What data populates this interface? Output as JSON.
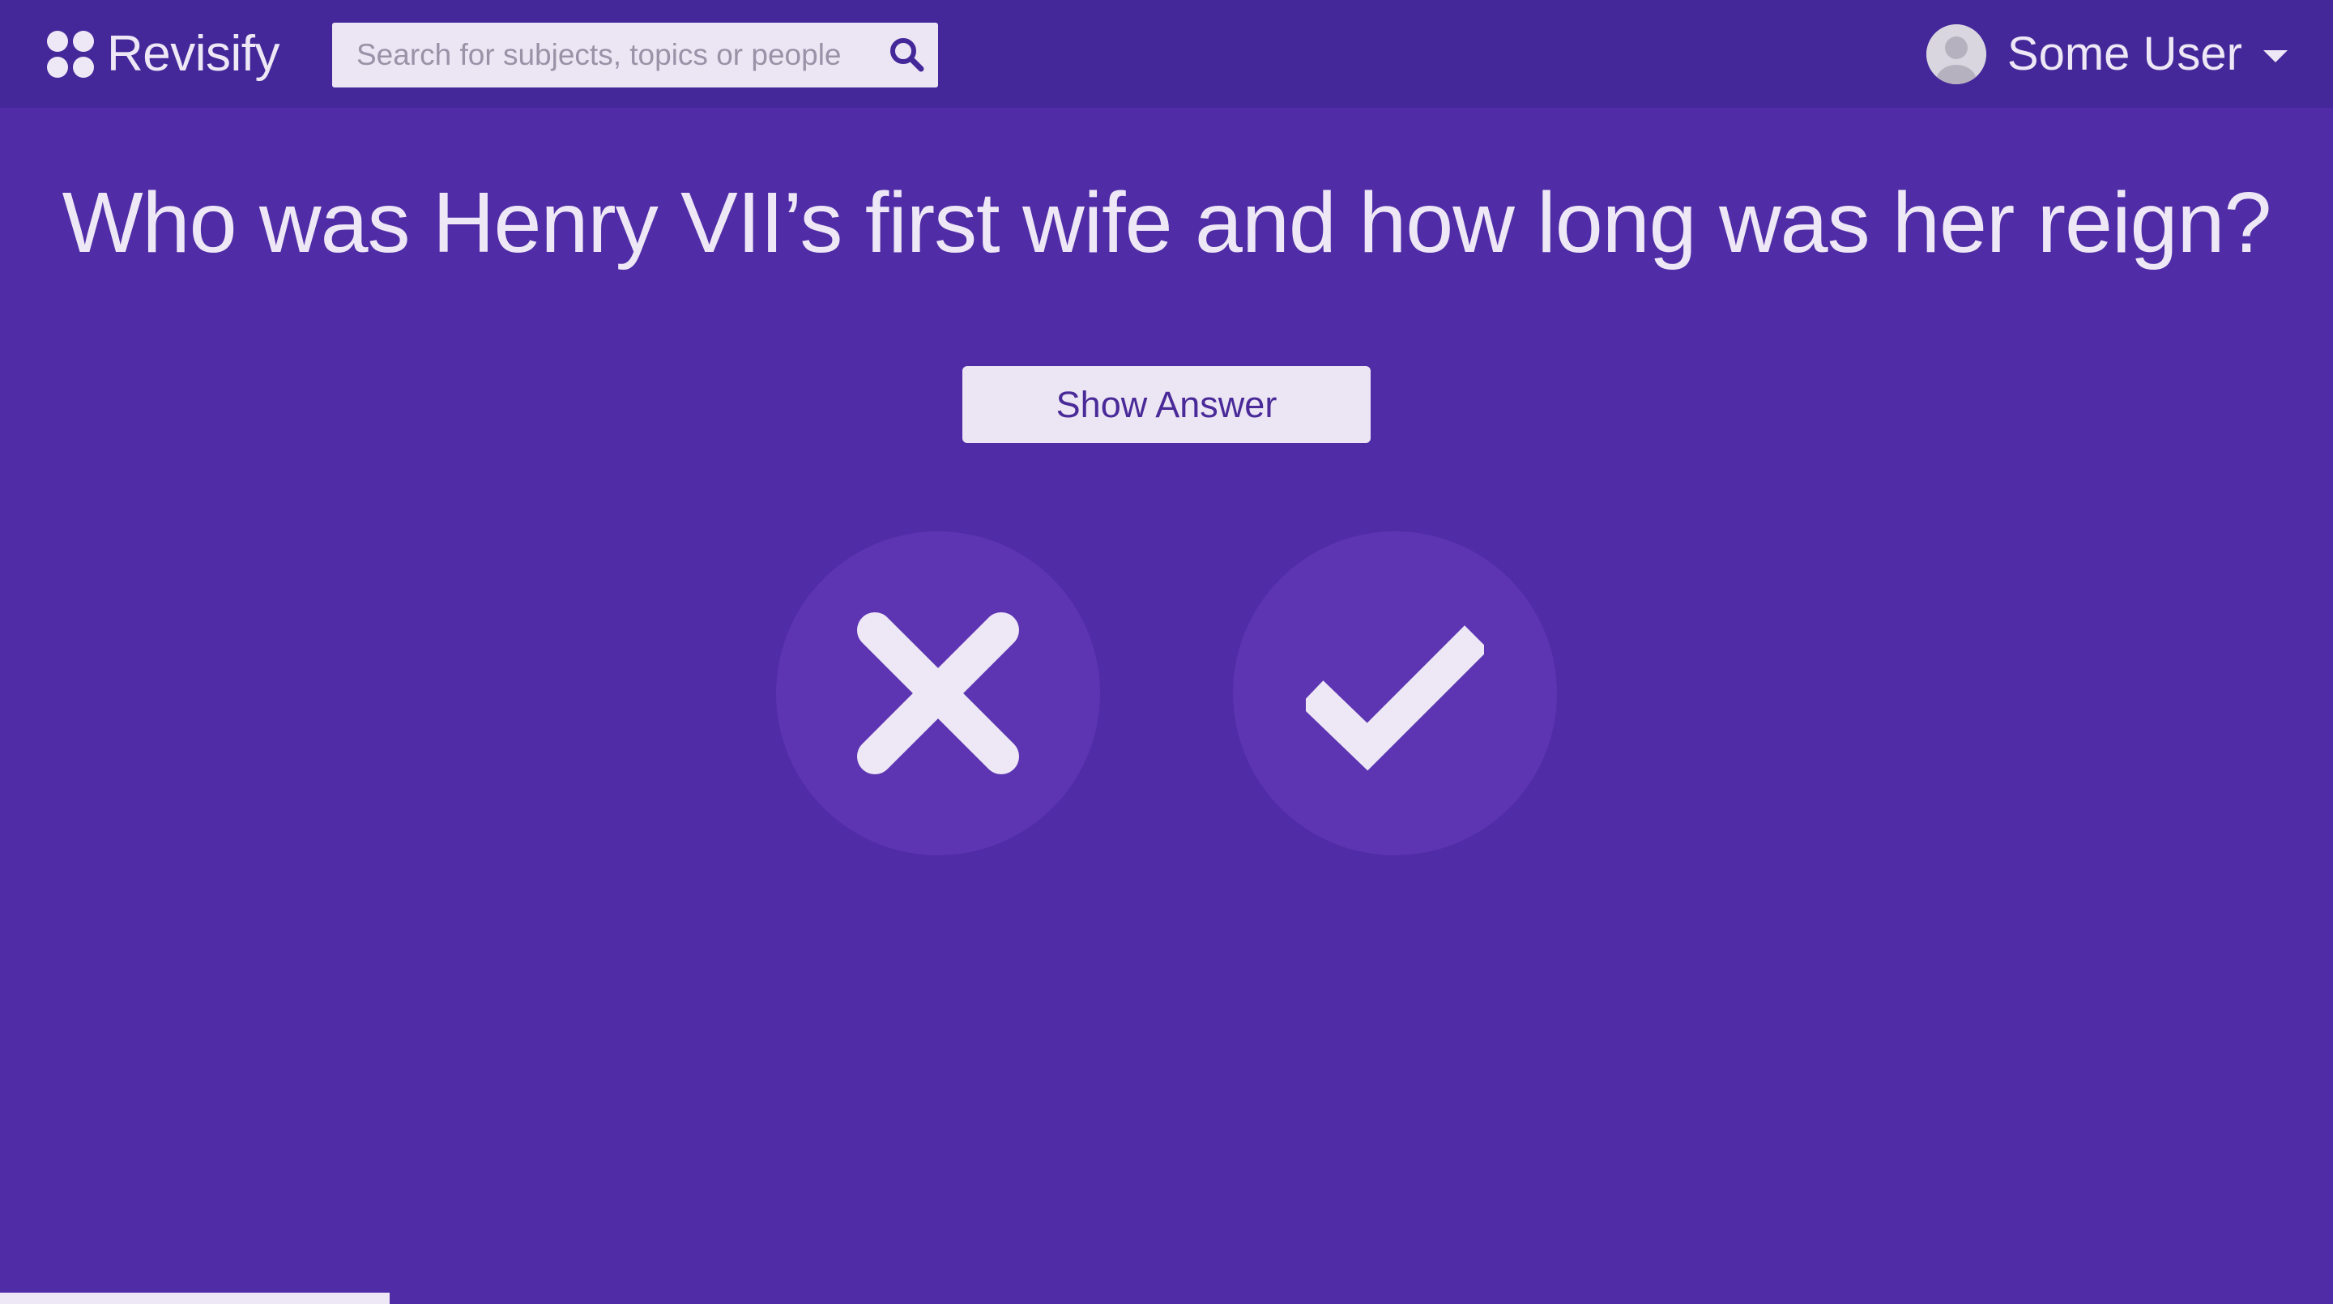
{
  "app": {
    "name": "Revisify"
  },
  "search": {
    "placeholder": "Search for subjects, topics or people",
    "icon": "search-icon"
  },
  "user": {
    "name": "Some User",
    "avatar_icon": "avatar-placeholder-icon",
    "menu_icon": "caret-down-icon"
  },
  "card": {
    "question": "Who was Henry VII’s first wife and how long was her reign?",
    "show_answer_label": "Show Answer",
    "wrong_icon": "cross-icon",
    "correct_icon": "check-icon"
  },
  "progress": {
    "fraction": 0.167
  },
  "colors": {
    "background": "#502ca6",
    "navbar": "#44289a",
    "circle_button": "#5d35b2",
    "light": "#eee8f6",
    "button_text": "#4a2a98"
  }
}
